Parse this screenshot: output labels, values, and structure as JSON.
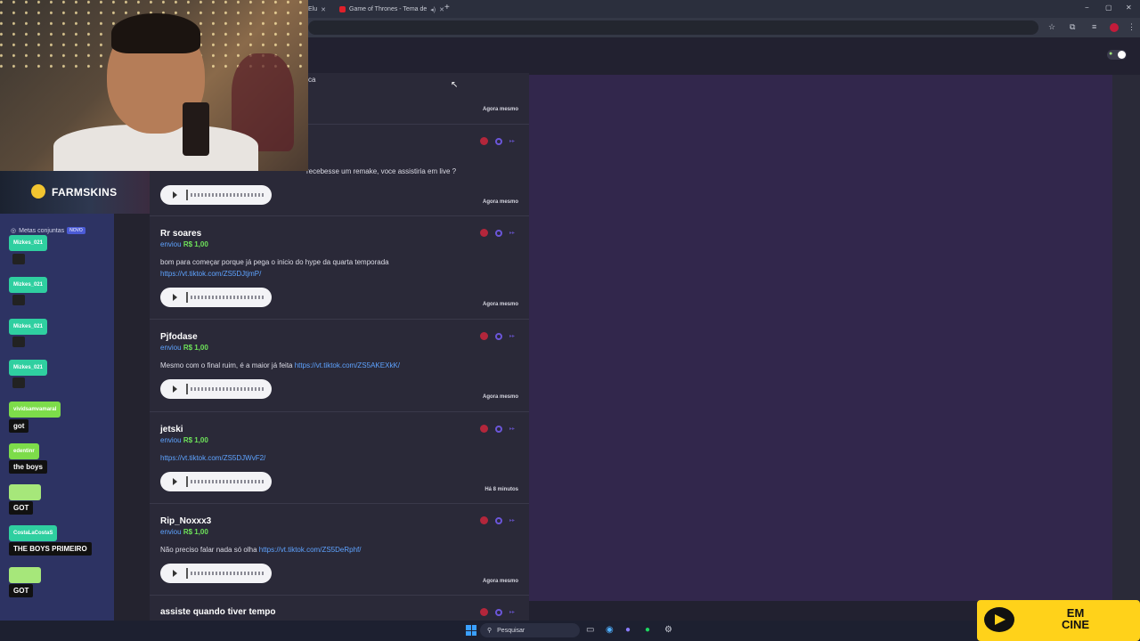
{
  "browser": {
    "tabs": [
      {
        "label": "Elu"
      },
      {
        "label": "Game of Thrones - Tema de"
      }
    ],
    "new_tab": "+",
    "win_min": "−",
    "win_max": "▢",
    "win_close": "✕"
  },
  "feed": {
    "top_fragment": "ca",
    "cards": [
      {
        "name": "",
        "sent": "",
        "amount": "",
        "message": "recebesse um remake, voce assistiria em live ?",
        "link": "",
        "time": "Agora mesmo"
      },
      {
        "name": "Rr soares",
        "sent": "enviou",
        "amount": "R$ 1,00",
        "message": "bom para começar porque já pega o inicio do hype da quarta temporada",
        "link": "https://vt.tiktok.com/ZS5DJtjmP/",
        "time": "Agora mesmo"
      },
      {
        "name": "Pjfodase",
        "sent": "enviou",
        "amount": "R$ 1,00",
        "message": "Mesmo com o final ruim, é a maior já feita",
        "link": "https://vt.tiktok.com/ZS5AKEXkK/",
        "time": "Agora mesmo"
      },
      {
        "name": "jetski",
        "sent": "enviou",
        "amount": "R$ 1,00",
        "message": "",
        "link": "https://vt.tiktok.com/ZS5DJWvF2/",
        "time": "Há 8 minutos"
      },
      {
        "name": "Rip_Noxxx3",
        "sent": "enviou",
        "amount": "R$ 1,00",
        "message": "Não preciso falar nada só olha",
        "link": "https://vt.tiktok.com/ZS5DeRphf/",
        "time": "Agora mesmo"
      },
      {
        "name": "assiste quando tiver tempo",
        "sent": "",
        "amount": "",
        "message": "",
        "link": "",
        "time": ""
      }
    ]
  },
  "overlay": {
    "sponsor": "FARMSKINS",
    "metas_label": "Metas conjuntas",
    "metas_badge": "NOVO",
    "chat": [
      {
        "user": "Mizkes_021",
        "text": ""
      },
      {
        "user": "Mizkes_021",
        "text": ""
      },
      {
        "user": "Mizkes_021",
        "text": ""
      },
      {
        "user": "Mizkes_021",
        "text": ""
      },
      {
        "user": "vividsamvamaral",
        "text": "got"
      },
      {
        "user": "edentinr",
        "text": "the boys"
      },
      {
        "user": "",
        "text": "GOT"
      },
      {
        "user": "CostaLaCostaS",
        "text": "THE BOYS PRIMEIRO"
      },
      {
        "user": "",
        "text": "GOT"
      }
    ],
    "emcine": "EM\nCINE"
  },
  "taskbar": {
    "search_label": "Pesquisar"
  },
  "colors": {
    "accent_link": "#5ea3ff",
    "amount_green": "#6ee35a",
    "chat_teal": "#2fcfa0",
    "chat_green": "#7ddc4a",
    "panel_purple": "#32274c"
  }
}
